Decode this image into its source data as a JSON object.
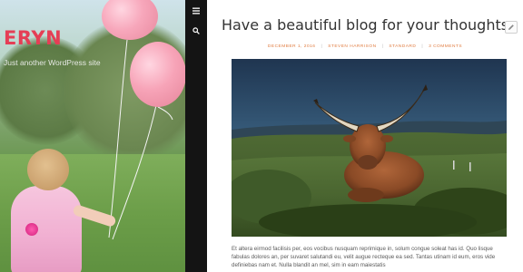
{
  "site": {
    "title": "ERYN",
    "tagline": "Just another WordPress site"
  },
  "toolbar": {
    "menu_icon": "hamburger-menu-icon",
    "search_icon": "search-icon"
  },
  "post": {
    "title": "Have a beautiful blog for your thoughts",
    "edit_icon": "pencil-edit-icon",
    "meta": [
      "December 1, 2016",
      "Steven Harrison",
      "Standard",
      "3 Comments"
    ],
    "featured_image": "highland-cow-lying-in-field",
    "excerpt": "Et altera eirmod facilisis per, eos vocibus nusquam reprimique in, solum congue soleat has id. Quo lisque fabulas dolores an, per suvaret salutandi eu, velit augue recteque ea sed. Tantas utinam id eum, eros vide definiebas nam et. Nulla blandit an mel, sim in eam maiestatis"
  },
  "colors": {
    "title_accent": "#e53e55",
    "meta_accent": "#e07b3f",
    "toolbar_bg": "#141414"
  }
}
